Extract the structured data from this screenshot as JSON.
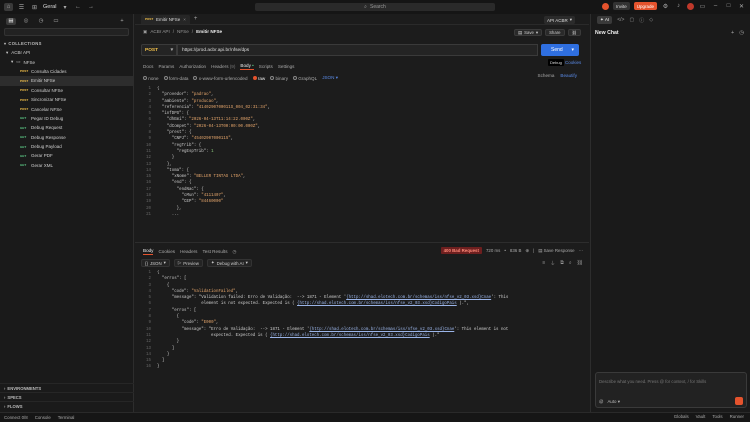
{
  "titlebar": {
    "workspace": "Geral",
    "search": "Search",
    "invite": "Invite",
    "upgrade": "Upgrade"
  },
  "sidebar": {
    "collections_label": "COLLECTIONS",
    "root": "ACBr API",
    "folder": "NFSe",
    "items": [
      {
        "method": "POST",
        "label": "Consulta Cidades"
      },
      {
        "method": "POST",
        "label": "Emitir NFSe"
      },
      {
        "method": "POST",
        "label": "Consultar NFSe"
      },
      {
        "method": "POST",
        "label": "Sincronizar NFSe"
      },
      {
        "method": "POST",
        "label": "Cancelar NFSe"
      },
      {
        "method": "GET",
        "label": "Pegar ID Debug"
      },
      {
        "method": "GET",
        "label": "Debug Request"
      },
      {
        "method": "GET",
        "label": "Debug Response"
      },
      {
        "method": "GET",
        "label": "Debug Payload"
      },
      {
        "method": "GET",
        "label": "Gerar PDF"
      },
      {
        "method": "GET",
        "label": "Gerar XML"
      }
    ],
    "bottom": [
      "ENVIRONMENTS",
      "SPECS",
      "FLOWS"
    ]
  },
  "tab": {
    "method": "POST",
    "label": "Emitir NFSe"
  },
  "environment": "API ACBR",
  "breadcrumb": {
    "root": "ACBr API",
    "sep": "/",
    "folder": "NFSe",
    "current": "Emitir NFSe"
  },
  "actions": {
    "save": "Save",
    "share": "Share"
  },
  "request": {
    "method": "POST",
    "url": "https://prod.acbr.api.br/nfse/dps",
    "send": "Send"
  },
  "tooltip": "Debug",
  "cookies": "Cookies",
  "req_tabs": [
    "Docs",
    "Params",
    "Authorization",
    "Headers",
    "Body",
    "Scripts",
    "Settings"
  ],
  "req_tab_headers_count": "(9)",
  "body_types": [
    "none",
    "form-data",
    "x-www-form-urlencoded",
    "raw",
    "binary",
    "GraphQL"
  ],
  "body_format": "JSON",
  "schema": "Schema",
  "beautify": "Beautify",
  "request_body": [
    "{",
    "  \"provedor\": \"padrao\",",
    "  \"ambiente\": \"producao\",",
    "  \"referencia\": \"4140290700011S_004_02:31:34\",",
    "  \"infDPS\": {",
    "    \"dhEmi\": \"2026-04-13T11:14:22.000Z\",",
    "    \"dCompet\": \"2026-04-13T00:00:00.000Z\",",
    "    \"prest\": {",
    "      \"CNPJ\": \"45402907000115\",",
    "      \"regTrib\": {",
    "        \"regEspTrib\": 1",
    "      }",
    "    },",
    "    \"toma\": {",
    "      \"xNome\": \"BELLER TINTAS LTDA\",",
    "      \"end\": {",
    "        \"endNac\": {",
    "          \"cMun\": \"4111407\",",
    "          \"CEP\": \"84460000\"",
    "        },",
    "      ..."
  ],
  "response": {
    "tabs": [
      "Body",
      "Cookies",
      "Headers",
      "Test Results"
    ],
    "status": "400 Bad Request",
    "time": "720 ms",
    "size": "836 B",
    "save": "Save Response",
    "format": "JSON",
    "preview": "Preview",
    "debug": "Debug with AI",
    "lines": [
      "{",
      "  \"erros\": [",
      "    {",
      "      \"code\": \"ValidationFailed\",",
      "      \"message\": \"Validation failed: Erro de Validação:  --> 1871 - Element '{http://shad.elotech.com.br/schemas/iss/nfse_v2_03.xsd}Cnae': This",
      "                  element is not expected. Expected is ( {http://shad.elotech.com.br/schemas/iss/nfse_v2_03.xsd}CodigoPais ).\",",
      "      \"erros\": [",
      "        {",
      "          \"code\": \"E000\",",
      "          \"message\": \"Erro de Validação:  --> 1871 - Element '{http://shad.elotech.com.br/schemas/iss/nfse_v2_03.xsd}Cnae': This element is not",
      "                      expected. Expected is ( {http://shad.elotech.com.br/schemas/iss/nfse_v2_03.xsd}CodigoPais ).\"",
      "        }",
      "      ]",
      "    }",
      "  ]",
      "}"
    ]
  },
  "statusbar": {
    "left": [
      "Connect 0/8",
      "Console",
      "Terminal"
    ],
    "right": [
      "Globals",
      "Vault",
      "Tools",
      "Runner"
    ]
  },
  "right_panel": {
    "ai_tab": "AI",
    "title": "New Chat",
    "placeholder": "Describe what you need. Press @ for context, / for Skills",
    "auto": "Auto"
  }
}
